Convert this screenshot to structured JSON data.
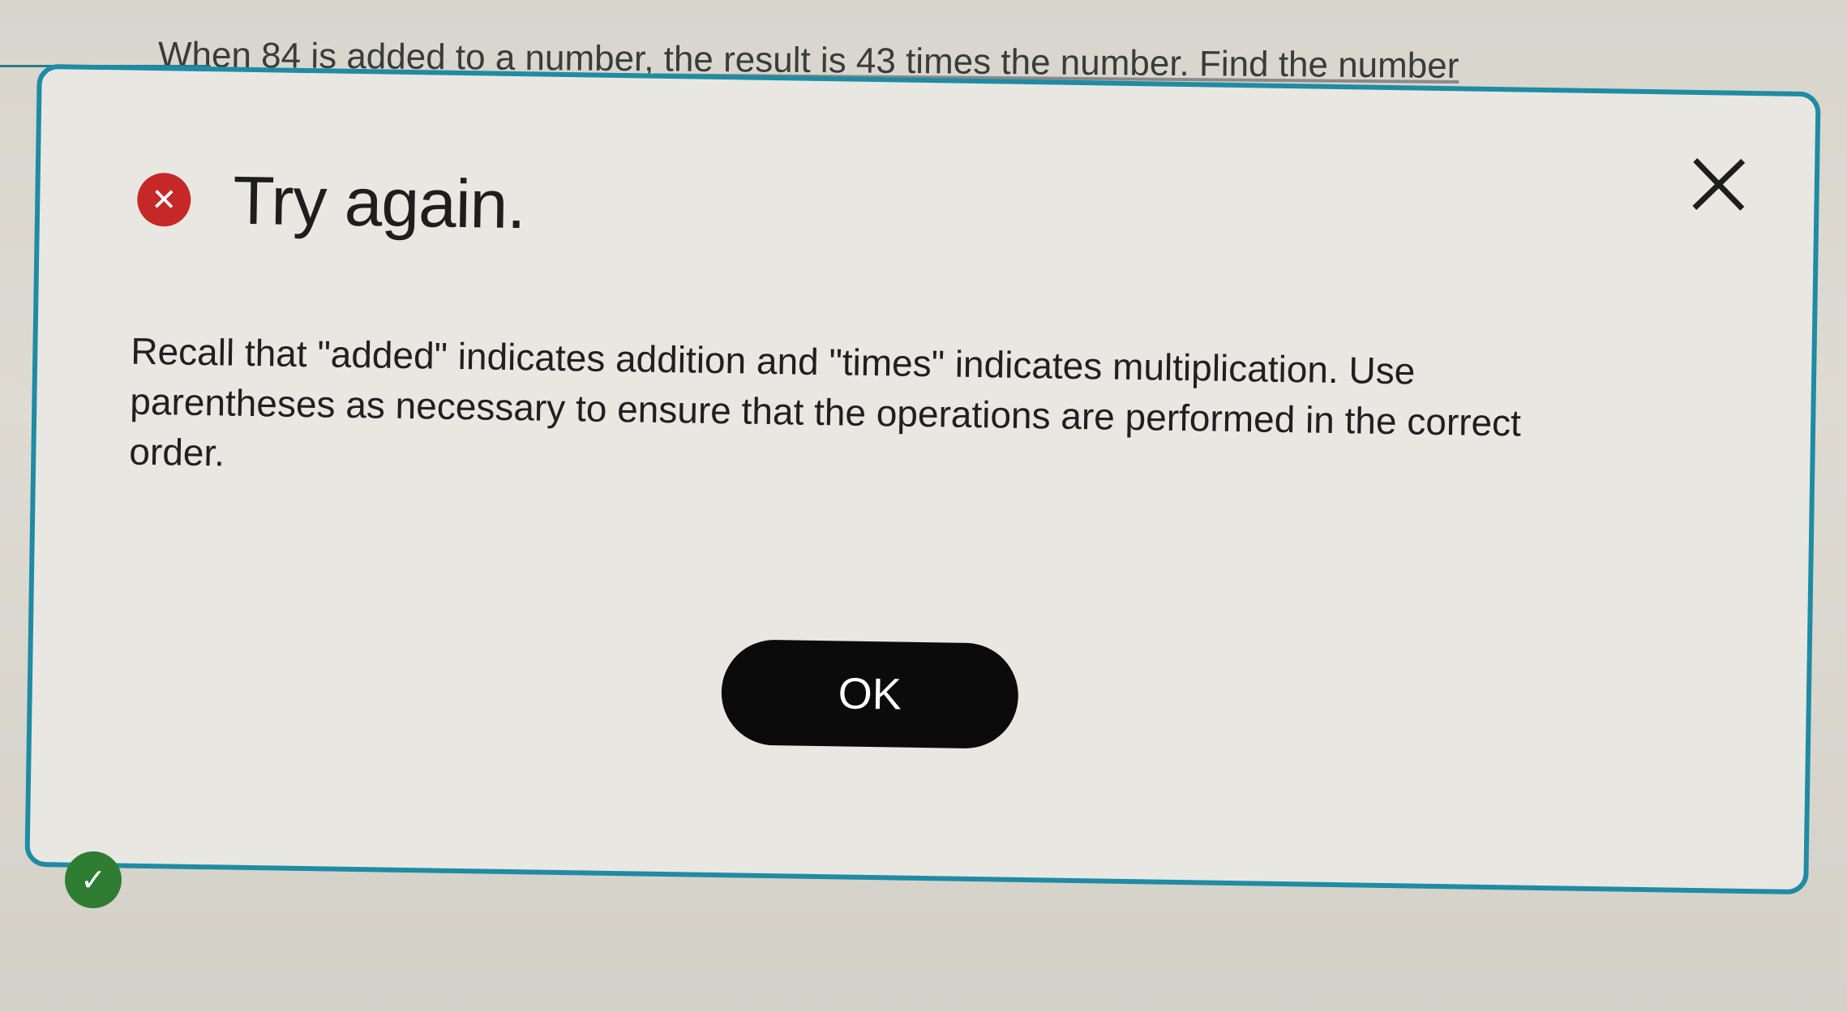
{
  "background": {
    "question_text": "When 84 is added to a number, the result is 43 times the number. Find the number"
  },
  "modal": {
    "status_icon": "error-circle-icon",
    "title": "Try again.",
    "close_icon": "close-x-icon",
    "message": "Recall that \"added\" indicates addition and \"times\" indicates multiplication. Use parentheses as necessary to ensure that the operations are performed in the correct order.",
    "ok_label": "OK"
  },
  "status": {
    "check_icon": "check-circle-icon"
  },
  "colors": {
    "border_accent": "#1f8ca3",
    "error_red": "#c62828",
    "button_black": "#0b0b0b",
    "success_green": "#2e7d32"
  }
}
